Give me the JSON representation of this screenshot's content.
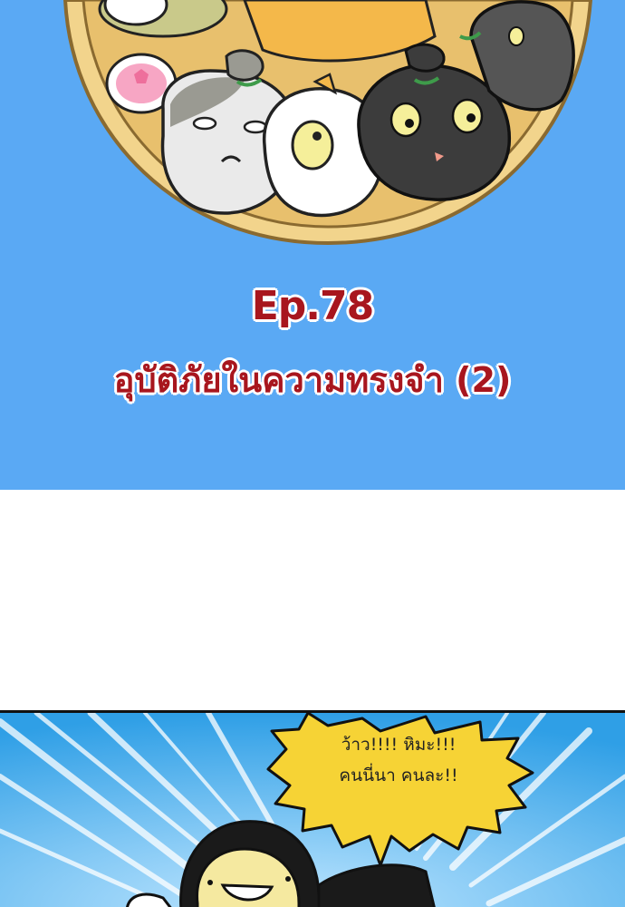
{
  "title_panel": {
    "episode_number": "Ep.78",
    "episode_title": "อุบัติภัยในความทรงจำ (2)",
    "background_color": "#5aa9f4",
    "title_color": "#a8161e"
  },
  "comic_panel": {
    "speech_bubble": {
      "line_1": "ว้าว!!!! หิมะ!!!",
      "line_2": "คนนี่นา คนละ!!"
    },
    "bubble_color": "#f6d335",
    "background_color": "#4fb2ec"
  }
}
